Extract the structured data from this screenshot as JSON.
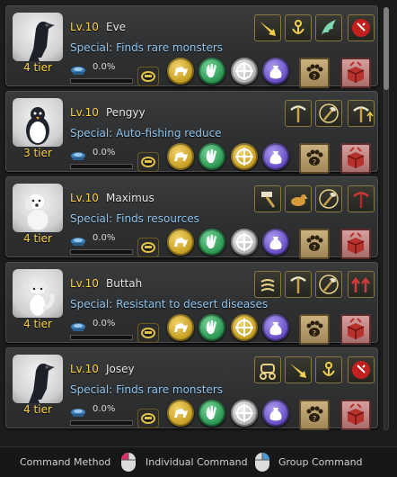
{
  "pets": [
    {
      "portrait": "crow-portrait",
      "level": "Lv.10",
      "name": "Eve",
      "special": "Special: Finds rare monsters",
      "tier": "4 tier",
      "feed_pct": "0.0%",
      "feed_fraction": 0.0,
      "skills": [
        "swoop-skill-icon",
        "grab-skill-icon",
        "wing-skill-icon",
        "red-alert-skill-icon"
      ]
    },
    {
      "portrait": "penguin-portrait",
      "level": "Lv.10",
      "name": "Pengyy",
      "special": "Special: Auto-fishing reduce",
      "tier": "3 tier",
      "feed_pct": "0.0%",
      "feed_fraction": 0.0,
      "skills": [
        "pickaxe-skill-icon",
        "axe-skill-icon",
        "pickaxe-up-skill-icon"
      ]
    },
    {
      "portrait": "dog-portrait",
      "level": "Lv.10",
      "name": "Maximus",
      "special": "Special: Finds resources",
      "tier": "4 tier",
      "feed_pct": "0.0%",
      "feed_fraction": 0.0,
      "skills": [
        "hammer-skill-icon",
        "bird-skill-icon",
        "axe-skill-icon",
        "red-pickaxe-skill-icon"
      ]
    },
    {
      "portrait": "fox-portrait",
      "level": "Lv.10",
      "name": "Buttah",
      "special": "Special: Resistant to desert diseases",
      "tier": "4 tier",
      "feed_pct": "0.0%",
      "feed_fraction": 0.0,
      "skills": [
        "coil-skill-icon",
        "pickaxe-skill-icon",
        "axe-skill-icon",
        "red-arrows-skill-icon"
      ]
    },
    {
      "portrait": "crow-portrait",
      "level": "Lv.10",
      "name": "Josey",
      "special": "Special: Finds rare monsters",
      "tier": "4 tier",
      "feed_pct": "0.0%",
      "feed_fraction": 0.0,
      "skills": [
        "carriage-skill-icon",
        "swoop-skill-icon",
        "grab-skill-icon",
        "red-alert-skill-icon"
      ]
    }
  ],
  "commands": [
    "follow-command-icon",
    "gather-command-icon",
    "targeting-command-icon",
    "loot-command-icon"
  ],
  "footer": {
    "method_label": "Command Method",
    "individual_label": "Individual Command",
    "group_label": "Group Command"
  },
  "colors": {
    "level": "#ffd23a",
    "name": "#e6e6e6",
    "special": "#8fc5ef",
    "tier": "#ffd23a",
    "cmd_gold": "#c9a227",
    "cmd_green": "#2e9a55",
    "cmd_silver": "#b8b8b8",
    "cmd_purple": "#6b52c8",
    "individual_mouse": "#d6316a",
    "group_mouse": "#4a9ad4"
  }
}
